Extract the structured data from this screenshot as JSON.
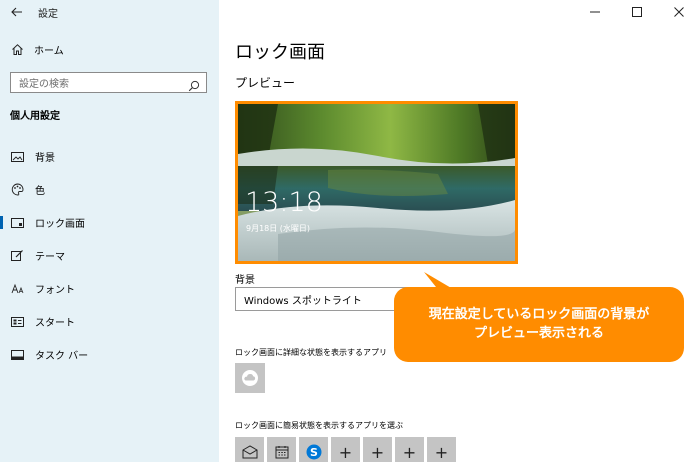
{
  "window": {
    "title": "設定",
    "back_icon": "back-arrow-icon",
    "minimize_icon": "minimize-icon",
    "maximize_icon": "maximize-icon",
    "close_icon": "close-icon"
  },
  "sidebar": {
    "home_label": "ホーム",
    "search_placeholder": "設定の検索",
    "section_title": "個人用設定",
    "items": [
      {
        "label": "背景",
        "icon": "image-icon"
      },
      {
        "label": "色",
        "icon": "palette-icon"
      },
      {
        "label": "ロック画面",
        "icon": "lock-screen-icon",
        "selected": true
      },
      {
        "label": "テーマ",
        "icon": "theme-brush-icon"
      },
      {
        "label": "フォント",
        "icon": "font-icon"
      },
      {
        "label": "スタート",
        "icon": "start-icon"
      },
      {
        "label": "タスク バー",
        "icon": "taskbar-icon"
      }
    ]
  },
  "main": {
    "page_title": "ロック画面",
    "preview_label": "プレビュー",
    "preview_time": "13:18",
    "preview_date": "9月18日 (水曜日)",
    "background_label": "背景",
    "background_value": "Windows スポットライト",
    "detail_app_label": "ロック画面に詳細な状態を表示するアプリ",
    "quick_apps_label": "ロック画面に簡易状態を表示するアプリを選ぶ",
    "plus_symbol": "+"
  },
  "callout": {
    "line1": "現在設定しているロック画面の背景が",
    "line2": "プレビュー表示される"
  },
  "colors": {
    "sidebar_bg": "#e6f2f7",
    "accent": "#0063b1",
    "callout": "#ff8c00"
  }
}
